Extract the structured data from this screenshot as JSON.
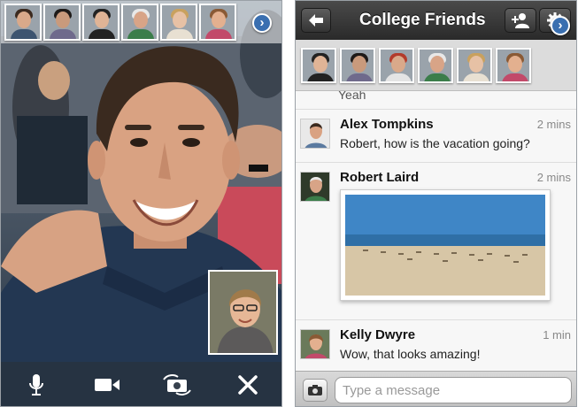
{
  "video_call": {
    "participants": [
      {
        "name": "participant-1",
        "skin": "#d9a98a",
        "hair": "#3b2a1f",
        "shirt": "#3d5470"
      },
      {
        "name": "participant-2",
        "skin": "#c99a7c",
        "hair": "#1e1a18",
        "shirt": "#6f6a8c"
      },
      {
        "name": "participant-3",
        "skin": "#e0b496",
        "hair": "#222222",
        "shirt": "#222222"
      },
      {
        "name": "participant-4",
        "skin": "#d8a487",
        "hair": "#e8e8e8",
        "shirt": "#3b7d4a"
      },
      {
        "name": "participant-5",
        "skin": "#e7c1a5",
        "hair": "#c9a15e",
        "shirt": "#e8e0d2"
      },
      {
        "name": "participant-6",
        "skin": "#e3b08f",
        "hair": "#8a5a35",
        "shirt": "#c24a6a"
      }
    ],
    "toolbar": {
      "mic": "microphone-icon",
      "camera": "video-camera-icon",
      "switch": "switch-camera-icon",
      "close": "close-icon"
    }
  },
  "chat": {
    "title": "College Friends",
    "previous_snippet": "Yeah",
    "participants": [
      {
        "name": "participant-1",
        "skin": "#e0b496",
        "hair": "#222222",
        "shirt": "#222222"
      },
      {
        "name": "participant-2",
        "skin": "#c99a7c",
        "hair": "#1e1a18",
        "shirt": "#6f6a8c"
      },
      {
        "name": "participant-3",
        "skin": "#d9a98a",
        "hair": "#b33b2b",
        "shirt": "#e4e4e4"
      },
      {
        "name": "participant-4",
        "skin": "#d8a487",
        "hair": "#e8e8e8",
        "shirt": "#3b7d4a"
      },
      {
        "name": "participant-5",
        "skin": "#e7c1a5",
        "hair": "#c9a15e",
        "shirt": "#e8e0d2"
      },
      {
        "name": "participant-6",
        "skin": "#e3b08f",
        "hair": "#8a5a35",
        "shirt": "#c24a6a"
      }
    ],
    "messages": [
      {
        "author": "Alex Tompkins",
        "time": "2 mins",
        "text": "Robert, how is the vacation going?"
      },
      {
        "author": "Robert Laird",
        "time": "2 mins",
        "text": ""
      },
      {
        "author": "Kelly Dwyre",
        "time": "1 min",
        "text": "Wow, that looks amazing!"
      }
    ],
    "composer": {
      "placeholder": "Type a message"
    }
  },
  "colors": {
    "accent": "#3a6fb0",
    "nav_dark": "#2a2a2a"
  }
}
